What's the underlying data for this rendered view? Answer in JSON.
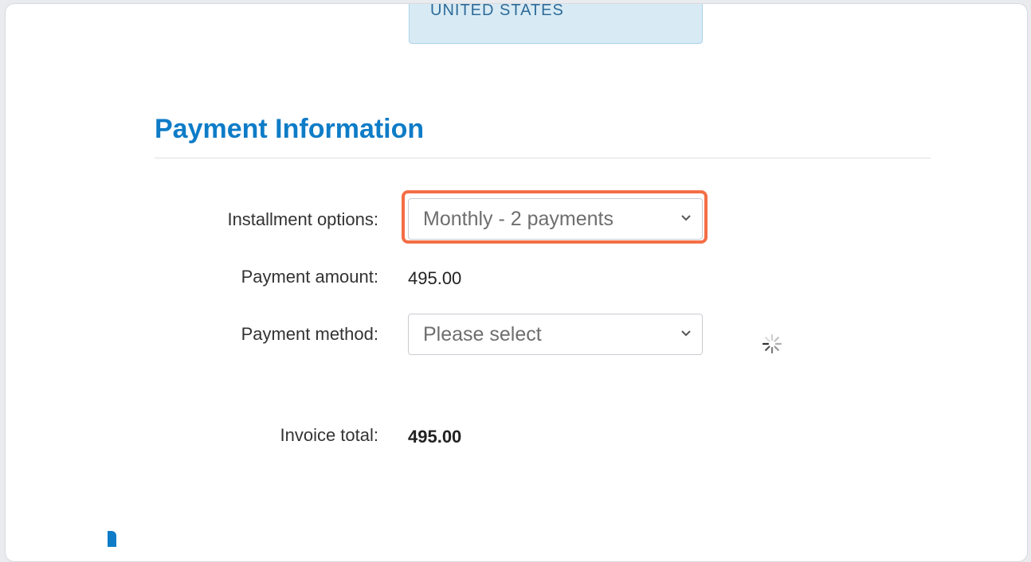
{
  "address_card": {
    "country": "UNITED STATES"
  },
  "payment_section": {
    "title": "Payment Information"
  },
  "installment": {
    "label": "Installment options:",
    "selected": "Monthly - 2 payments"
  },
  "payment_amount": {
    "label": "Payment amount:",
    "value": "495.00"
  },
  "payment_method": {
    "label": "Payment method:",
    "selected": "Please select"
  },
  "invoice_total": {
    "label": "Invoice total:",
    "value": "495.00"
  },
  "colors": {
    "accent": "#0e7cc7",
    "highlight": "#f46e46",
    "address_background": "#d8ebf5"
  },
  "icons": {
    "dropdown": "chevron-down-icon",
    "loading": "loading-spinner-icon"
  }
}
